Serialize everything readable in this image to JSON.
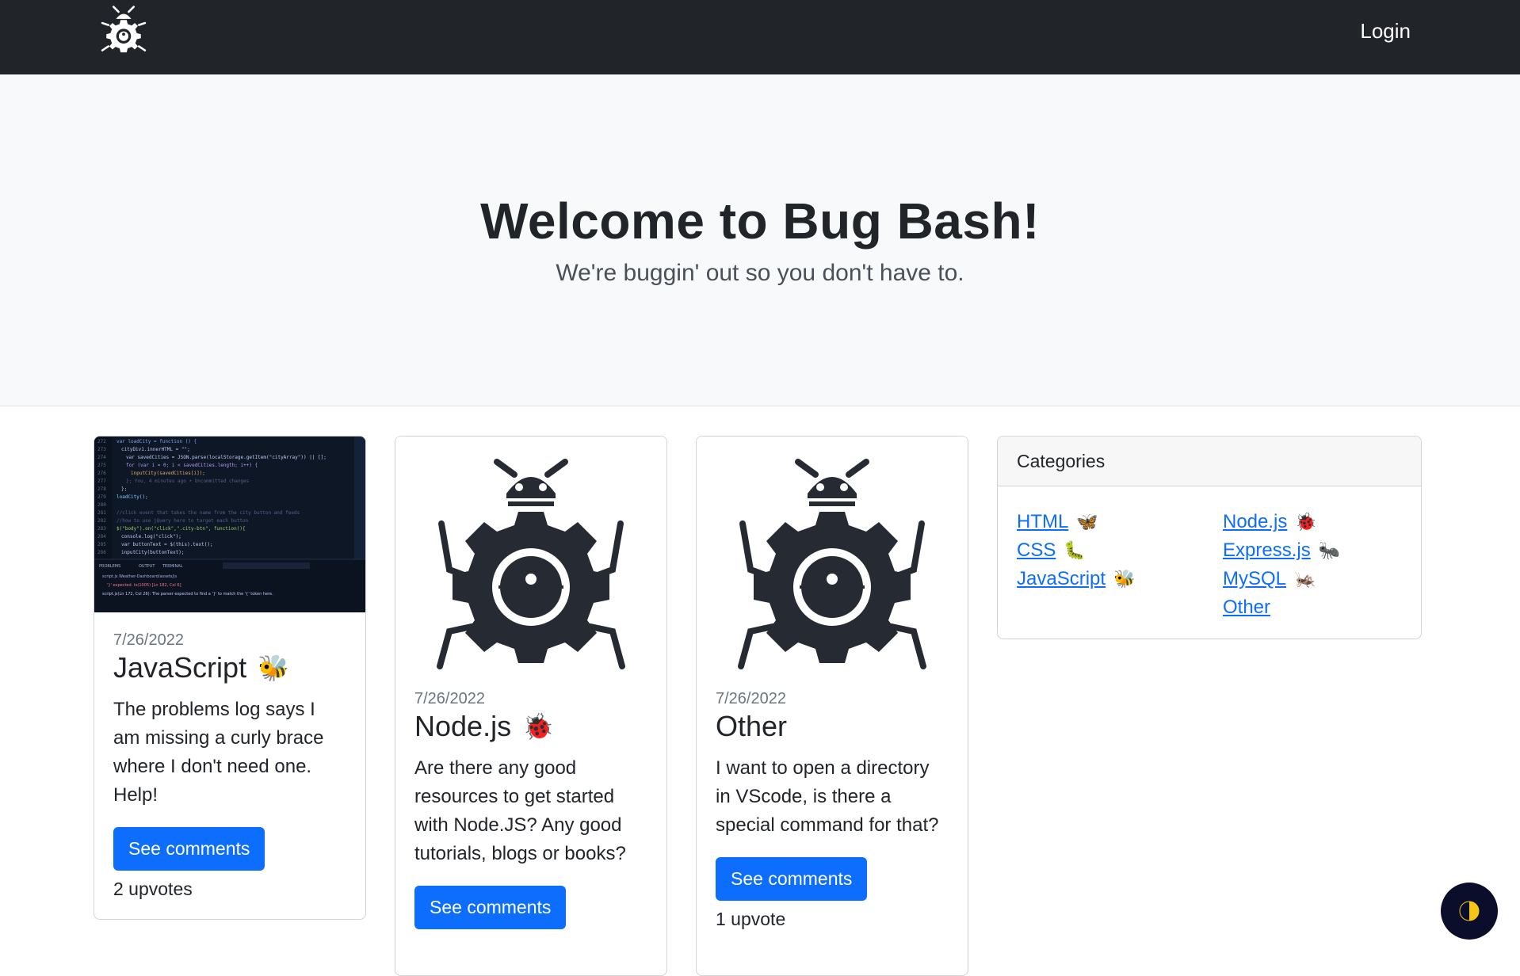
{
  "nav": {
    "login_label": "Login"
  },
  "hero": {
    "title": "Welcome to Bug Bash!",
    "subtitle": "We're buggin' out so you don't have to."
  },
  "posts": [
    {
      "date": "7/26/2022",
      "category": "JavaScript",
      "emoji": "🐝",
      "text": "The problems log says I am missing a curly brace where I don't need one. Help!",
      "button": "See comments",
      "upvotes": "2 upvotes"
    },
    {
      "date": "7/26/2022",
      "category": "Node.js",
      "emoji": "🐞",
      "text": "Are there any good resources to get started with Node.JS? Any good tutorials, blogs or books?",
      "button": "See comments",
      "upvotes": ""
    },
    {
      "date": "7/26/2022",
      "category": "Other",
      "emoji": "",
      "text": "I want to open a directory in VScode, is there a special command for that?",
      "button": "See comments",
      "upvotes": "1 upvote"
    }
  ],
  "categories": {
    "title": "Categories",
    "left": [
      {
        "label": "HTML",
        "emoji": "🦋"
      },
      {
        "label": "CSS",
        "emoji": "🐛"
      },
      {
        "label": "JavaScript",
        "emoji": "🐝"
      }
    ],
    "right": [
      {
        "label": "Node.js",
        "emoji": "🐞"
      },
      {
        "label": "Express.js",
        "emoji": "🐜"
      },
      {
        "label": "MySQL",
        "emoji": "🦗"
      },
      {
        "label": "Other",
        "emoji": ""
      }
    ]
  },
  "icons": {
    "logo": "bug-gear-icon",
    "theme": "half-moon-icon"
  },
  "colors": {
    "navbar": "#212529",
    "hero_bg": "#f8f9fa",
    "primary": "#0d6efd",
    "link": "#0d6efd"
  }
}
